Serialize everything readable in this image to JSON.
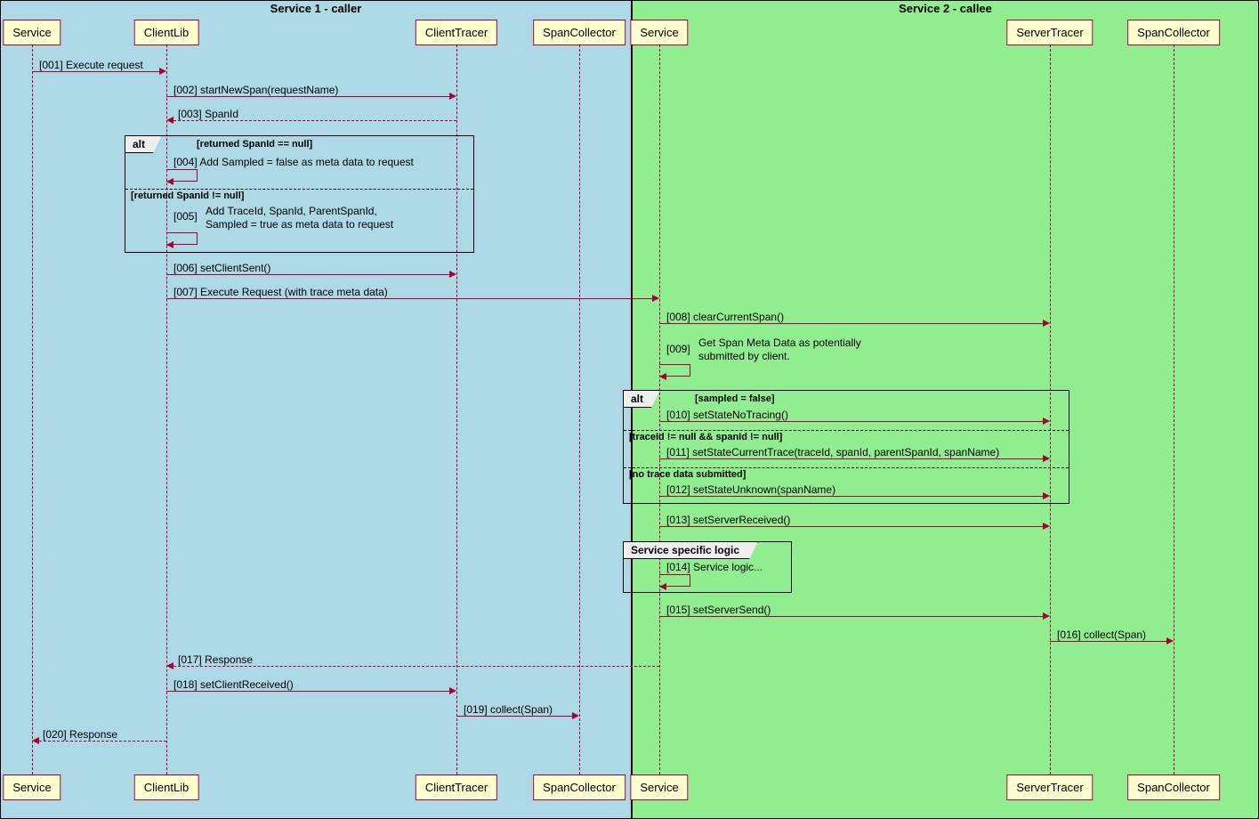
{
  "boxes": {
    "box1": "Service 1 - caller",
    "box2": "Service 2 - callee"
  },
  "participants": {
    "p1": "Service",
    "p2": "ClientLib",
    "p3": "ClientTracer",
    "p4": "SpanCollector",
    "p5": "Service",
    "p6": "ServerTracer",
    "p7": "SpanCollector"
  },
  "messages": {
    "m001": "[001] Execute request",
    "m002": "[002] startNewSpan(requestName)",
    "m003": "[003] SpanId",
    "m004_text": "[004] Add Sampled = false as meta data to request",
    "m005_num": "[005]",
    "m005_text": "Add TraceId, SpanId, ParentSpanId,\nSampled = true as meta data to request",
    "m006": "[006] setClientSent()",
    "m007": "[007] Execute Request (with trace meta data)",
    "m008": "[008] clearCurrentSpan()",
    "m009_num": "[009]",
    "m009_text": "Get Span Meta Data as potentially\nsubmitted by client.",
    "m010": "[010] setStateNoTracing()",
    "m011": "[011] setStateCurrentTrace(traceId, spanId, parentSpanId, spanName)",
    "m012": "[012] setStateUnknown(spanName)",
    "m013": "[013] setServerReceived()",
    "m014": "[014] Service logic...",
    "m015": "[015] setServerSend()",
    "m016": "[016] collect(Span)",
    "m017": "[017] Response",
    "m018": "[018] setClientReceived()",
    "m019": "[019] collect(Span)",
    "m020": "[020] Response"
  },
  "frames": {
    "alt1": "alt",
    "alt1_g1": "[returned SpanId == null]",
    "alt1_g2": "[returned SpanId != null]",
    "alt2": "alt",
    "alt2_g1": "[sampled = false]",
    "alt2_g2": "[traceId != null && spanId != null]",
    "alt2_g3": "[no trace data submitted]",
    "ref1": "Service specific logic"
  }
}
